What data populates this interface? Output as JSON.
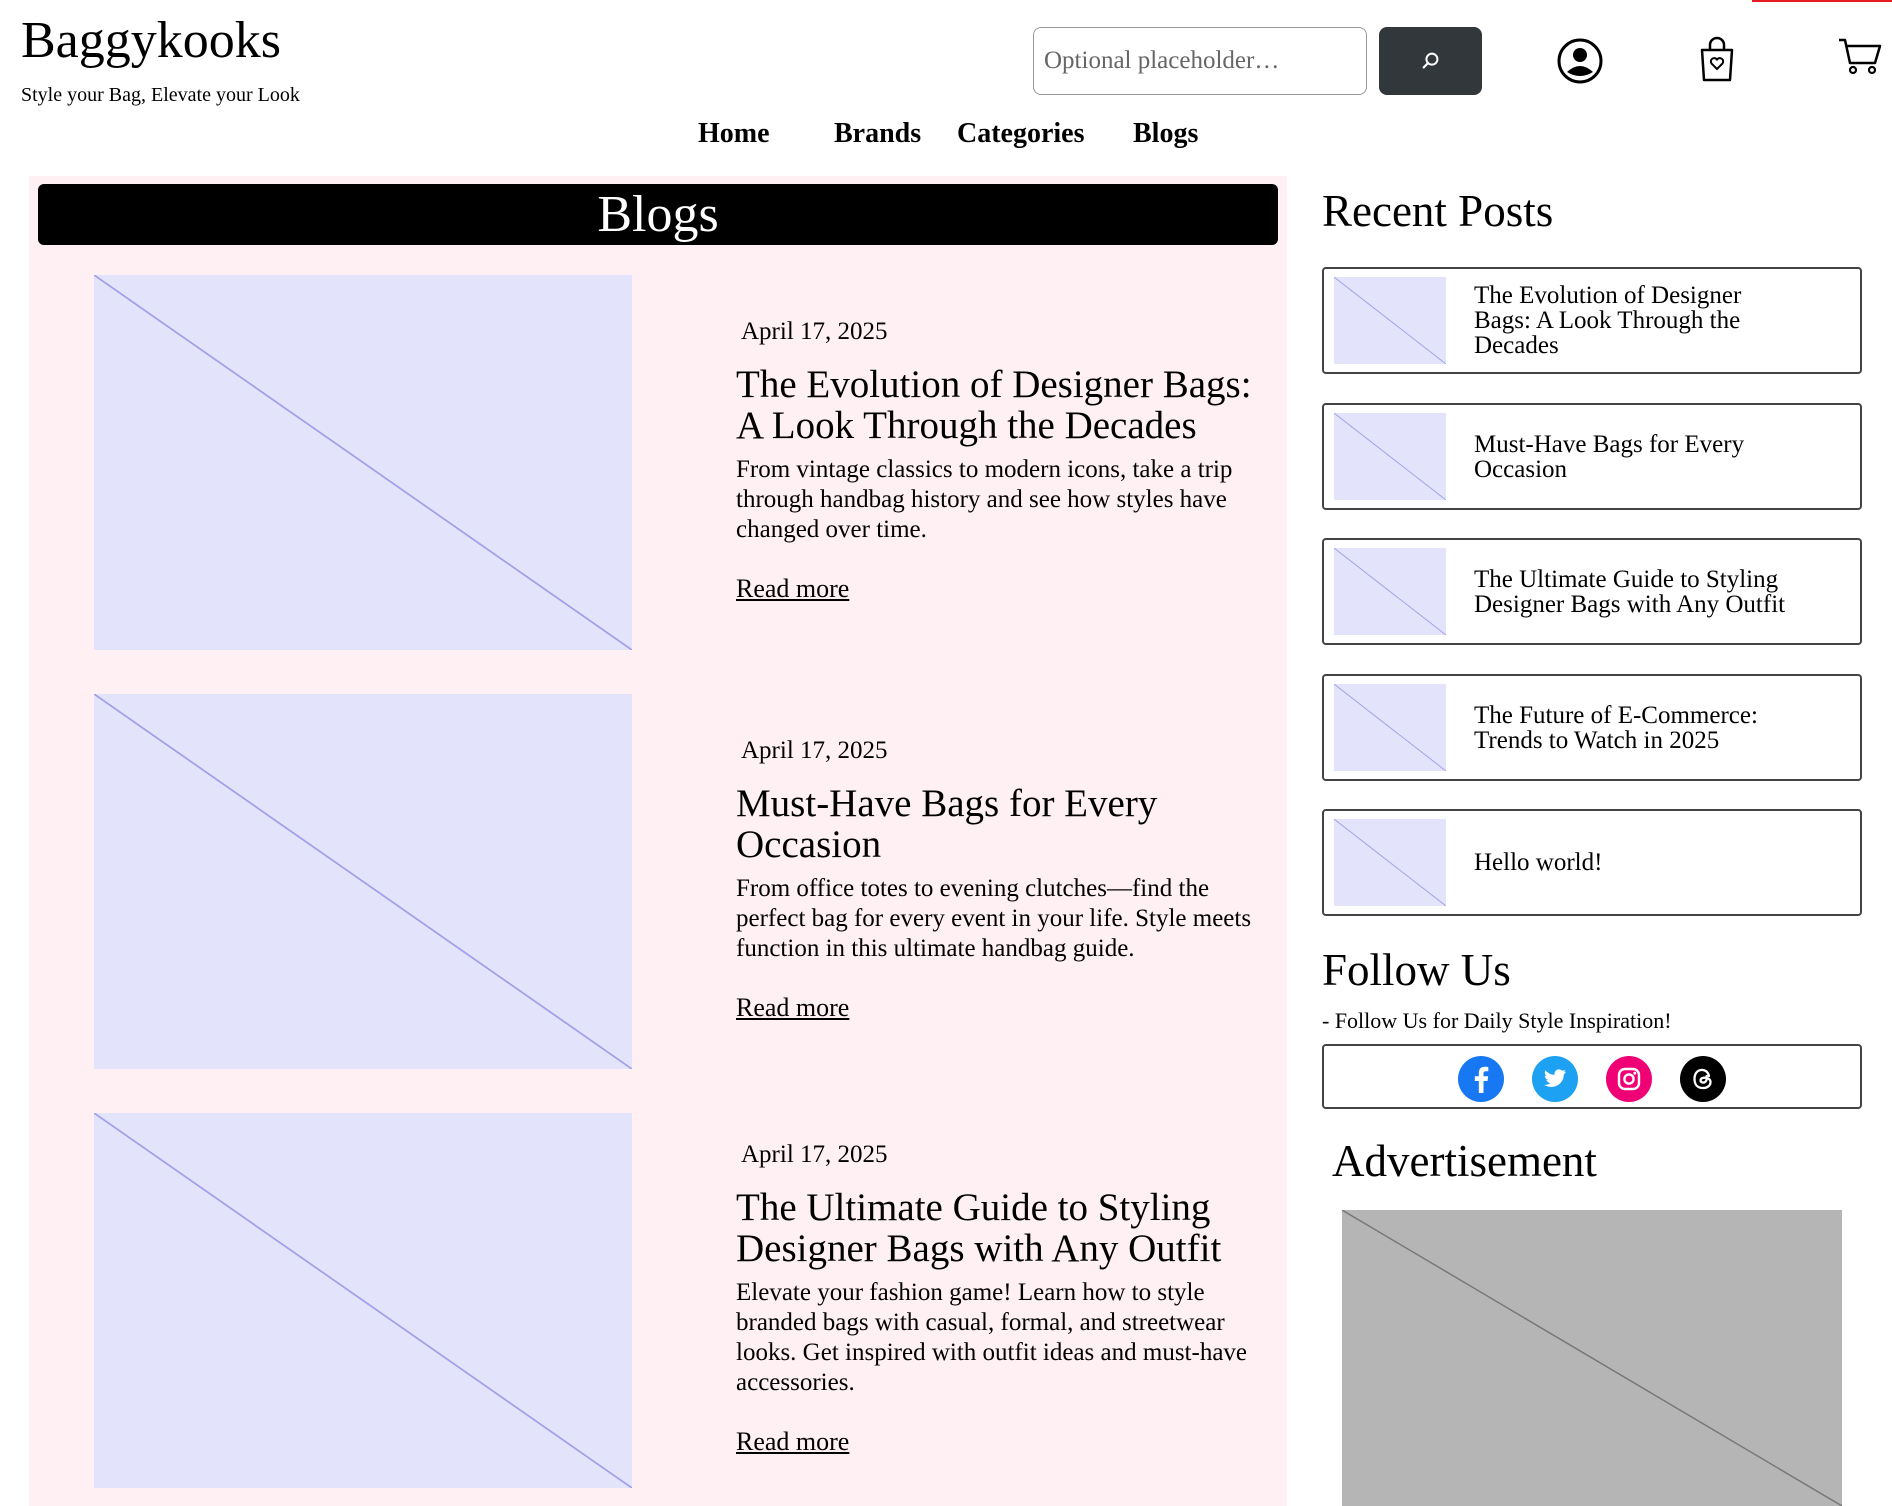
{
  "header": {
    "logo": "Baggykooks",
    "tagline": "Style your Bag, Elevate your Look",
    "search_placeholder": "Optional placeholder…",
    "search_button_icon": "search-icon",
    "icons": [
      "account-icon",
      "wishlist-bag-icon",
      "cart-icon"
    ]
  },
  "nav": {
    "items": [
      {
        "label": "Home"
      },
      {
        "label": "Brands"
      },
      {
        "label": "Categories"
      },
      {
        "label": "Blogs"
      }
    ]
  },
  "main": {
    "banner": "Blogs",
    "posts": [
      {
        "date": "April 17, 2025",
        "title": "The Evolution of Designer Bags: A Look Through the Decades",
        "excerpt": "From vintage classics to modern icons, take a trip through handbag history and see how styles have changed over time.",
        "read_more": "Read more"
      },
      {
        "date": "April 17, 2025",
        "title": "Must-Have Bags for Every Occasion",
        "excerpt": "From office totes to evening clutches—find the perfect bag for every event in your life. Style meets function in this ultimate handbag guide.",
        "read_more": "Read more"
      },
      {
        "date": "April 17, 2025",
        "title": "The Ultimate Guide to Styling Designer Bags with Any Outfit",
        "excerpt": "Elevate your fashion game! Learn how to style branded bags with casual, formal, and streetwear looks. Get inspired with outfit ideas and must-have accessories.",
        "read_more": "Read more"
      }
    ]
  },
  "sidebar": {
    "recent_heading": "Recent Posts",
    "recent_posts": [
      {
        "title": "The Evolution of Designer Bags: A Look Through the Decades"
      },
      {
        "title": "Must-Have Bags for Every Occasion"
      },
      {
        "title": "The Ultimate Guide to Styling Designer Bags with Any Outfit"
      },
      {
        "title": "The Future of E-Commerce: Trends to Watch in 2025"
      },
      {
        "title": "Hello world!"
      }
    ],
    "follow_heading": "Follow Us",
    "follow_sub": "- Follow Us for Daily Style Inspiration!",
    "socials": [
      {
        "name": "facebook-icon",
        "color": "#1877f2"
      },
      {
        "name": "twitter-icon",
        "color": "#1da1f2"
      },
      {
        "name": "instagram-icon",
        "color": "#f00075"
      },
      {
        "name": "threads-icon",
        "color": "#000000"
      }
    ],
    "ad_heading": "Advertisement"
  },
  "colors": {
    "main_panel_bg": "#fff0f3",
    "banner_bg": "#000000",
    "search_button_bg": "#32373c",
    "placeholder_image_bg": "#e3e3fb",
    "ad_image_bg": "#b5b5b5"
  }
}
